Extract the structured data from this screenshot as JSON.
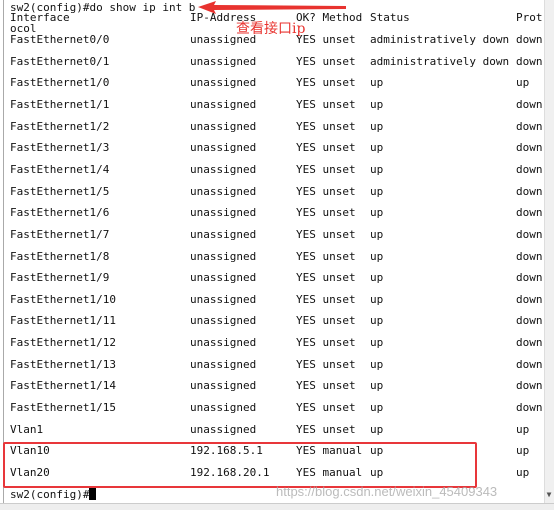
{
  "command_line": "sw2(config)#do show ip int b",
  "headers": {
    "interface": "Interface",
    "ip": "IP-Address",
    "ok_method": "OK? Method",
    "status": "Status",
    "protocol": "Prot",
    "protocol_wrap": "ocol"
  },
  "annotation": "查看接口ip",
  "rows": [
    [
      "FastEthernet0/0",
      "unassigned",
      "YES unset",
      "administratively down",
      "down"
    ],
    [
      "FastEthernet0/1",
      "unassigned",
      "YES unset",
      "administratively down",
      "down"
    ],
    [
      "FastEthernet1/0",
      "unassigned",
      "YES unset",
      "up",
      "up"
    ],
    [
      "FastEthernet1/1",
      "unassigned",
      "YES unset",
      "up",
      "down"
    ],
    [
      "FastEthernet1/2",
      "unassigned",
      "YES unset",
      "up",
      "down"
    ],
    [
      "FastEthernet1/3",
      "unassigned",
      "YES unset",
      "up",
      "down"
    ],
    [
      "FastEthernet1/4",
      "unassigned",
      "YES unset",
      "up",
      "down"
    ],
    [
      "FastEthernet1/5",
      "unassigned",
      "YES unset",
      "up",
      "down"
    ],
    [
      "FastEthernet1/6",
      "unassigned",
      "YES unset",
      "up",
      "down"
    ],
    [
      "FastEthernet1/7",
      "unassigned",
      "YES unset",
      "up",
      "down"
    ],
    [
      "FastEthernet1/8",
      "unassigned",
      "YES unset",
      "up",
      "down"
    ],
    [
      "FastEthernet1/9",
      "unassigned",
      "YES unset",
      "up",
      "down"
    ],
    [
      "FastEthernet1/10",
      "unassigned",
      "YES unset",
      "up",
      "down"
    ],
    [
      "FastEthernet1/11",
      "unassigned",
      "YES unset",
      "up",
      "down"
    ],
    [
      "FastEthernet1/12",
      "unassigned",
      "YES unset",
      "up",
      "down"
    ],
    [
      "FastEthernet1/13",
      "unassigned",
      "YES unset",
      "up",
      "down"
    ],
    [
      "FastEthernet1/14",
      "unassigned",
      "YES unset",
      "up",
      "down"
    ],
    [
      "FastEthernet1/15",
      "unassigned",
      "YES unset",
      "up",
      "down"
    ],
    [
      "Vlan1",
      "unassigned",
      "YES unset",
      "up",
      "up"
    ],
    [
      "Vlan10",
      "192.168.5.1",
      "YES manual",
      "up",
      "up"
    ],
    [
      "Vlan20",
      "192.168.20.1",
      "YES manual",
      "up",
      "up"
    ]
  ],
  "prompt": "sw2(config)#",
  "watermark": "https://blog.csdn.net/weixin_45409343",
  "colors": {
    "annotation": "#e8332f",
    "highlight": "#e8363a"
  }
}
